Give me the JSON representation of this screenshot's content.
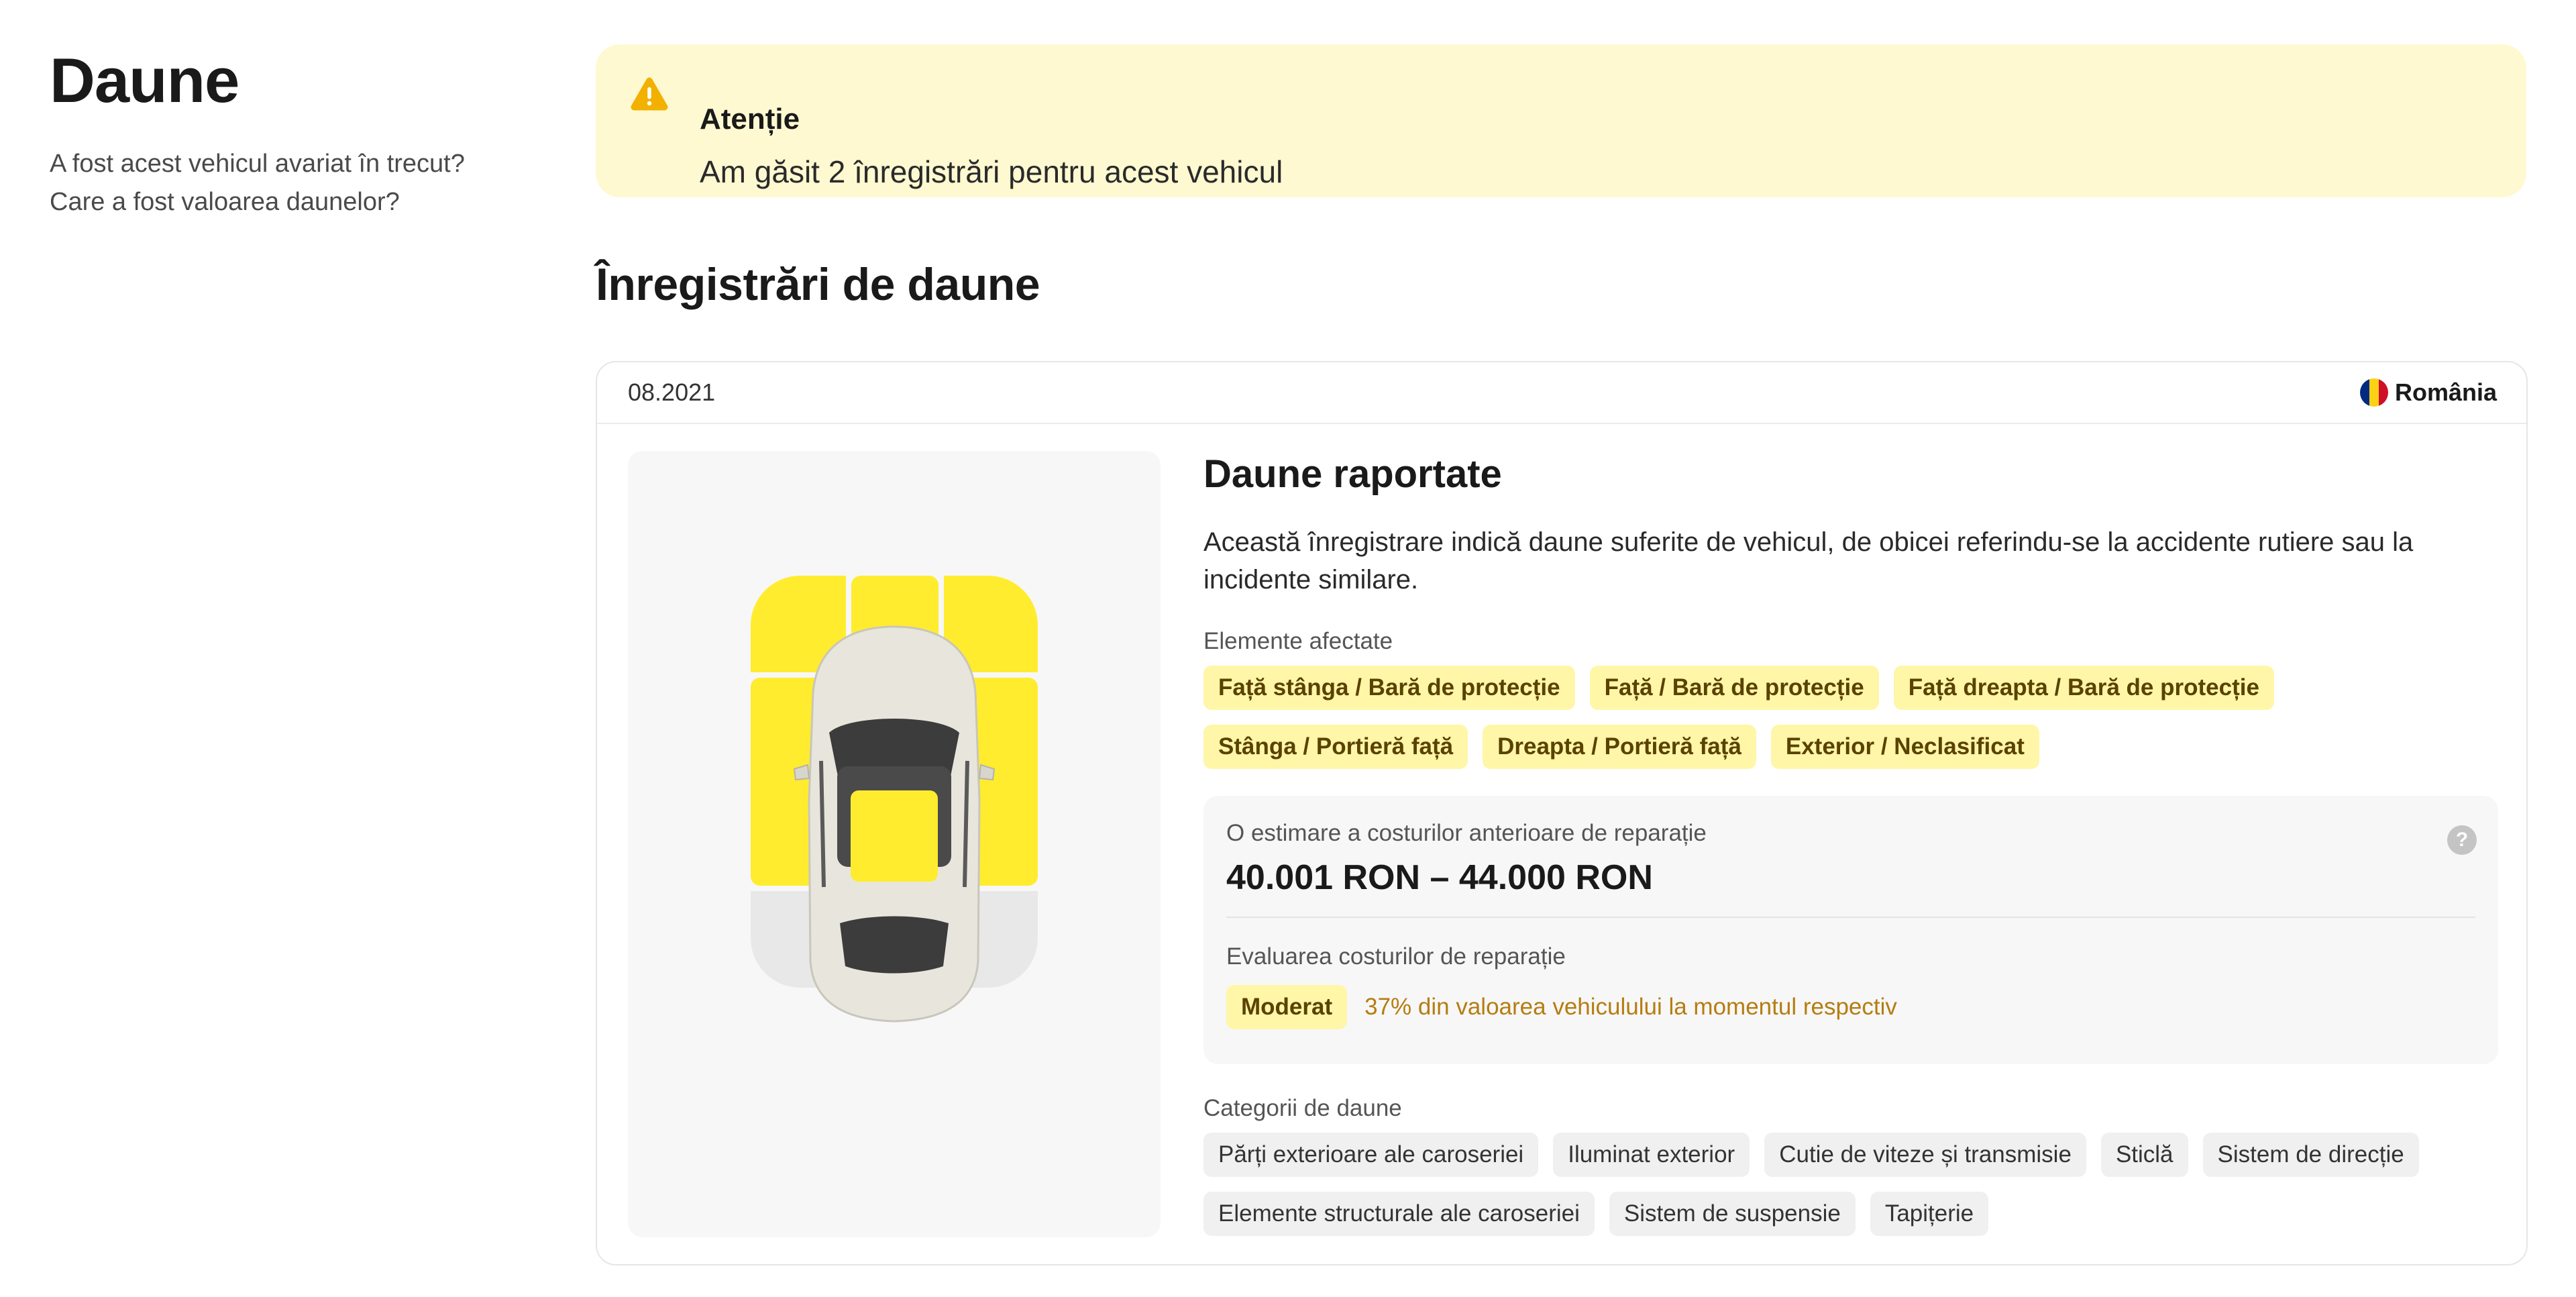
{
  "left": {
    "title": "Daune",
    "subtitle_line1": "A fost acest vehicul avariat în trecut?",
    "subtitle_line2": "Care a fost valoarea daunelor?"
  },
  "alert": {
    "title": "Atenție",
    "text": "Am găsit 2 înregistrări pentru acest vehicul",
    "icon": "warning-triangle-icon",
    "color": "#f2b100"
  },
  "records": {
    "section_title": "Înregistrări de daune",
    "items": [
      {
        "date": "08.2021",
        "country": "România",
        "title": "Daune raportate",
        "description": "Această înregistrare indică daune suferite de vehicul, de obicei referindu-se la accidente rutiere sau la incidente similare.",
        "affected_label": "Elemente afectate",
        "affected_elements": [
          "Față stânga / Bară de protecție",
          "Față / Bară de protecție",
          "Față dreapta / Bară de protecție",
          "Stânga / Portieră față",
          "Dreapta / Portieră față",
          "Exterior / Neclasificat"
        ],
        "estimate_label": "O estimare a costurilor anterioare de reparație",
        "estimate_value": "40.001 RON – 44.000 RON",
        "evaluation_label": "Evaluarea costurilor de reparație",
        "rating": "Moderat",
        "rating_text": "37% din valoarea vehiculului la momentul respectiv",
        "categories_label": "Categorii de daune",
        "categories": [
          "Părți exterioare ale caroseriei",
          "Iluminat exterior",
          "Cutie de viteze și transmisie",
          "Sticlă",
          "Sistem de direcție",
          "Elemente structurale ale caroseriei",
          "Sistem de suspensie",
          "Tapițerie"
        ]
      }
    ]
  },
  "colors": {
    "damage_highlight": "#ffec2e",
    "undamaged_zone": "#e8e8e8",
    "alert_background": "#fff9d1",
    "rating_text": "#b57d10"
  },
  "help_icon": "?"
}
